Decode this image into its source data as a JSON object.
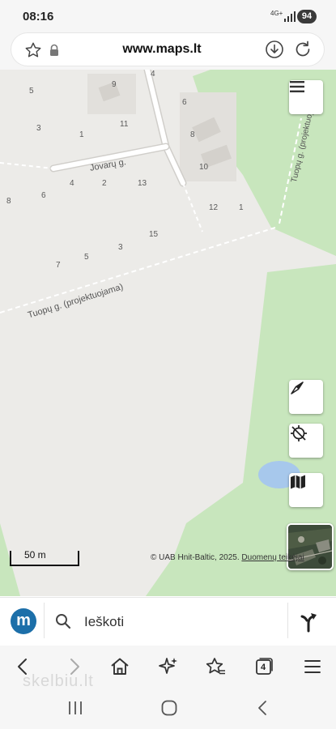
{
  "status_bar": {
    "time": "08:16",
    "network": "4G+",
    "battery": "94"
  },
  "browser": {
    "url": "www.maps.lt",
    "tab_count": "4"
  },
  "map": {
    "house_numbers": [
      "9",
      "4",
      "5",
      "6",
      "3",
      "11",
      "1",
      "8",
      "10",
      "2",
      "13",
      "4",
      "6",
      "8",
      "12",
      "1",
      "15",
      "3",
      "5",
      "7"
    ],
    "street_labels": {
      "jovaru": "Jovarų g.",
      "tuopu_vertical": "Tuopų g. (projektuojama)",
      "tuopu_diagonal": "Tuopų g. (projektuojama)"
    },
    "scale_label": "50 m",
    "attribution": "© UAB Hnit-Baltic, 2025.",
    "attribution_link": "Duomenų teikėjai"
  },
  "search": {
    "logo_letter": "m",
    "placeholder": "Ieškoti"
  },
  "watermark": "skelbiu.lt",
  "colors": {
    "park": "#c8e6bd",
    "water": "#a7c8ec",
    "brand": "#1c6fa9",
    "land": "#ecebe8"
  }
}
